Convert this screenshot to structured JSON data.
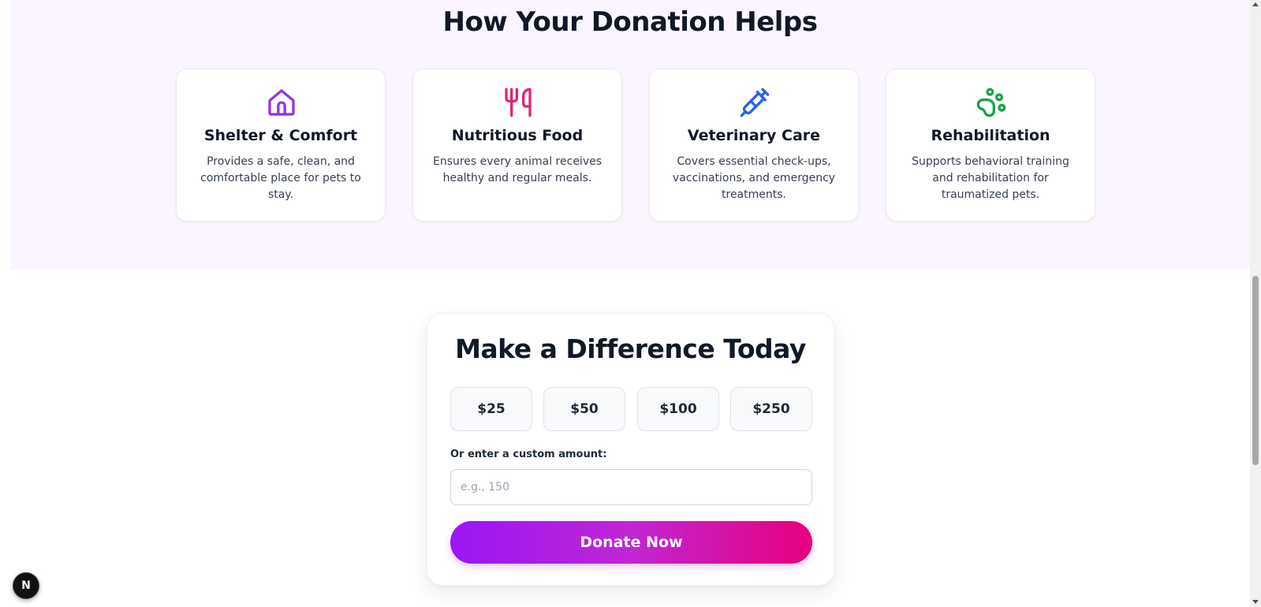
{
  "helps_section": {
    "title": "How Your Donation Helps",
    "cards": [
      {
        "icon": "house-icon",
        "icon_color": "#9333ea",
        "title": "Shelter & Comfort",
        "description": "Provides a safe, clean, and comfortable place for pets to stay."
      },
      {
        "icon": "utensils-icon",
        "icon_color": "#db2777",
        "title": "Nutritious Food",
        "description": "Ensures every animal receives healthy and regular meals."
      },
      {
        "icon": "syringe-icon",
        "icon_color": "#2563eb",
        "title": "Veterinary Care",
        "description": "Covers essential check-ups, vaccinations, and emergency treatments."
      },
      {
        "icon": "paw-icon",
        "icon_color": "#16a34a",
        "title": "Rehabilitation",
        "description": "Supports behavioral training and rehabilitation for traumatized pets."
      }
    ],
    "background_color": "#faf5ff"
  },
  "donation_form": {
    "title": "Make a Difference Today",
    "amounts": [
      "$25",
      "$50",
      "$100",
      "$250"
    ],
    "custom_label": "Or enter a custom amount:",
    "custom_input": {
      "value": "",
      "placeholder": "e.g., 150"
    },
    "donate_button": "Donate Now",
    "button_gradient": [
      "#9a16f5",
      "#e8007f"
    ]
  },
  "dev_badge": {
    "label": "N"
  }
}
